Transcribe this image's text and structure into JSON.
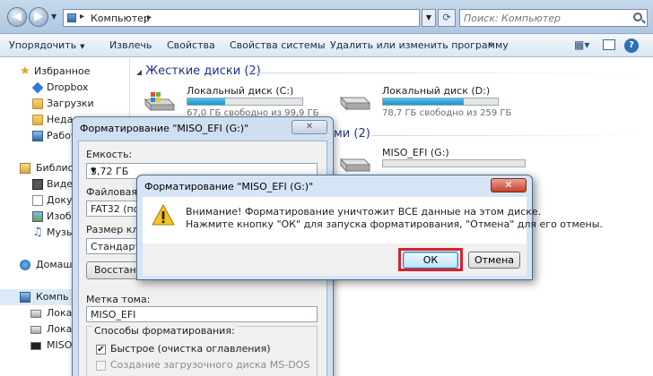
{
  "address": {
    "path": "Компьютер",
    "search_placeholder": "Поиск: Компьютер"
  },
  "toolbar": {
    "organize": "Упорядочить",
    "eject": "Извлечь",
    "properties": "Свойства",
    "system_properties": "Свойства системы",
    "uninstall": "Удалить или изменить программу",
    "more": "»"
  },
  "sidebar": {
    "favorites": "Избранное",
    "dropbox": "Dropbox",
    "downloads": "Загрузки",
    "recent": "Недав",
    "desktop": "Рабоч",
    "libraries": "Библио",
    "videos": "Видео",
    "documents": "Доку",
    "images": "Изобр",
    "music": "Музы",
    "homegroup": "Домаш",
    "computer": "Компь",
    "local1": "Локал",
    "local2": "Локал",
    "miso": "MISO_"
  },
  "main": {
    "hdd_group": "Жесткие диски (2)",
    "removable_group_suffix": "ми (2)",
    "drives": [
      {
        "name": "Локальный диск (C:)",
        "free": "67,0 ГБ свободно из 99,9 ГБ",
        "used_fraction": 0.33
      },
      {
        "name": "Локальный диск (D:)",
        "free": "78,7 ГБ свободно из 259 ГБ",
        "used_fraction": 0.7
      }
    ],
    "removable": {
      "name": "MISO_EFI (G:)"
    }
  },
  "format_dialog": {
    "title": "Форматирование \"MISO_EFI (G:)\"",
    "capacity_label": "Емкость:",
    "capacity_value": "3,72 ГБ",
    "fs_label": "Файловая систем",
    "fs_value": "FAT32 (по ум",
    "cluster_label": "Размер класт",
    "cluster_value": "Стандартны",
    "restore_button": "Восстанов",
    "volume_label": "Метка тома:",
    "volume_value": "MISO_EFI",
    "methods_label": "Способы форматирования:",
    "quick_format": "Быстрое (очистка оглавления)",
    "msdos_disk": "Создание загрузочного диска MS-DOS"
  },
  "warning_dialog": {
    "title": "Форматирование \"MISO_EFI (G:)\"",
    "line1": "Внимание! Форматирование уничтожит ВСЕ данные на этом диске.",
    "line2": "Нажмите кнопку \"ОК\" для запуска форматирования, \"Отмена\" для его отмены.",
    "ok": "ОК",
    "cancel": "Отмена",
    "close": "✕"
  },
  "colors": {
    "highlight": "#d3232f",
    "drive_bar": "#1e93c9",
    "group_header": "#1e3287"
  }
}
